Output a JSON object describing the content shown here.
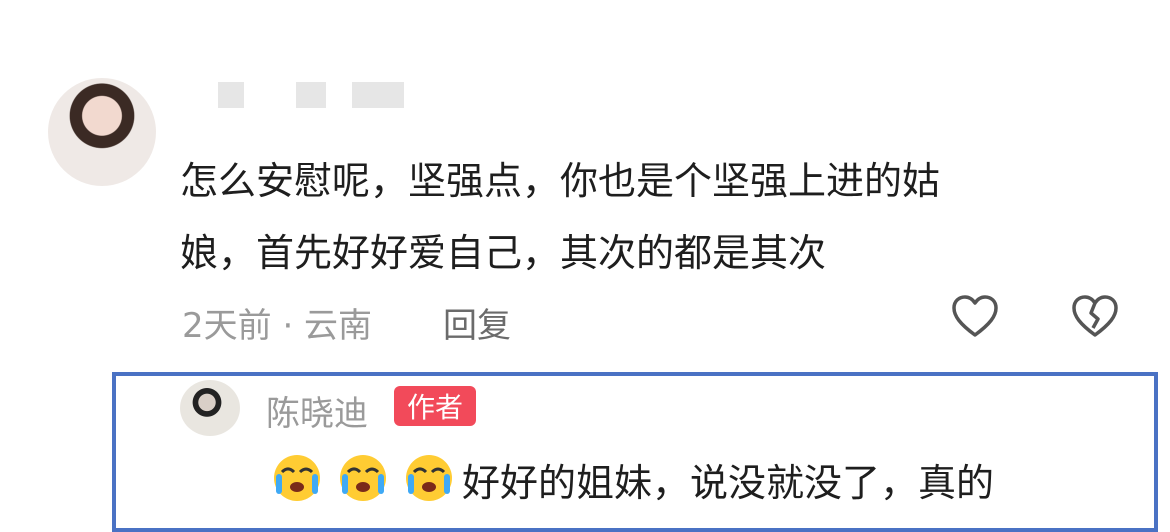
{
  "comment": {
    "text_line1": "怎么安慰呢，坚强点，你也是个坚强上进的姑",
    "text_line2": "娘，首先好好爱自己，其次的都是其次",
    "meta": "2天前 · 云南",
    "reply_label": "回复"
  },
  "reply": {
    "username": "陈晓迪",
    "badge": "作者",
    "text": "好好的姐妹，说没就没了，真的"
  },
  "colors": {
    "highlight_border": "#4a72c4",
    "badge_bg": "#f24a5a"
  },
  "icons": [
    "heart-icon",
    "broken-heart-icon",
    "crying-emoji-icon"
  ]
}
